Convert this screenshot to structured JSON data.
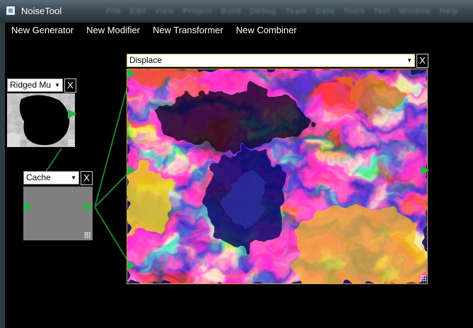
{
  "window": {
    "title": "NoiseTool"
  },
  "menu": {
    "new_generator": "New Generator",
    "new_modifier": "New Modifier",
    "new_transformer": "New Transformer",
    "new_combiner": "New Combiner"
  },
  "nodes": {
    "ridged": {
      "module": "Ridged Mu",
      "close": "X"
    },
    "cache": {
      "module": "Cache",
      "close": "X"
    },
    "displace": {
      "module": "Displace",
      "close": "X"
    }
  },
  "colors": {
    "port": "#2db34a",
    "wire": "#1e7d32",
    "cache_preview": "#7f7f7f"
  }
}
